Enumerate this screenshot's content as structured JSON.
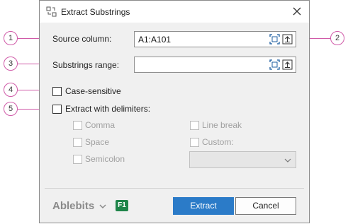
{
  "window": {
    "title": "Extract Substrings"
  },
  "source": {
    "label": "Source column:",
    "value": "A1:A101"
  },
  "range": {
    "label": "Substrings range:",
    "value": ""
  },
  "options": {
    "case_sensitive": "Case-sensitive",
    "extract_with_delimiters": "Extract with delimiters:"
  },
  "delimiters": {
    "comma": "Comma",
    "space": "Space",
    "semicolon": "Semicolon",
    "line_break": "Line break",
    "custom": "Custom:",
    "custom_dropdown_value": ""
  },
  "footer": {
    "brand": "Ablebits",
    "help": "F1",
    "extract_button": "Extract",
    "cancel_button": "Cancel"
  },
  "callouts": [
    "1",
    "2",
    "3",
    "4",
    "5"
  ],
  "colors": {
    "callout": "#d05aa8",
    "primary_button": "#2b7bc8",
    "help_badge": "#1e8449"
  }
}
